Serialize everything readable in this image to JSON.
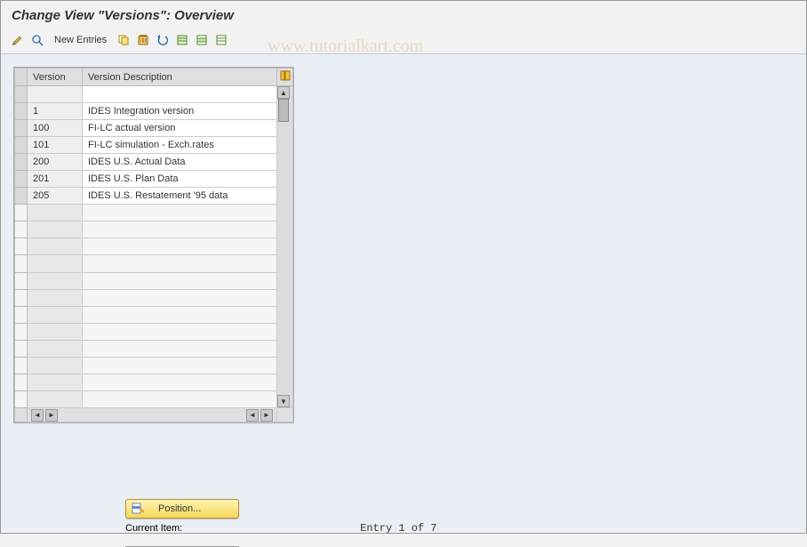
{
  "header": {
    "title": "Change View \"Versions\": Overview"
  },
  "toolbar": {
    "toggle_label": "",
    "glasses_label": "",
    "new_entries_label": "New Entries",
    "copy_label": "",
    "delete_label": "",
    "undo_label": "",
    "select_all_label": "",
    "select_block_label": "",
    "deselect_label": ""
  },
  "table": {
    "columns": {
      "version": "Version",
      "description": "Version Description"
    },
    "rows": [
      {
        "version": "",
        "description": ""
      },
      {
        "version": "1",
        "description": "IDES Integration version"
      },
      {
        "version": "100",
        "description": "FI-LC actual version"
      },
      {
        "version": "101",
        "description": "FI-LC simulation - Exch.rates"
      },
      {
        "version": "200",
        "description": "IDES U.S. Actual Data"
      },
      {
        "version": "201",
        "description": "IDES U.S. Plan Data"
      },
      {
        "version": "205",
        "description": "IDES U.S. Restatement '95 data"
      }
    ],
    "empty_row_count": 12
  },
  "footer": {
    "position_label": "Position...",
    "current_item_label": "Current Item:",
    "entry_label": "Entry 1 of 7"
  },
  "watermark": "www.tutorialkart.com"
}
